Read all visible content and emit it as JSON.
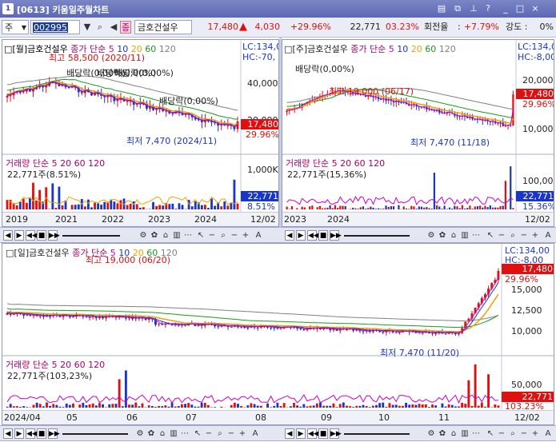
{
  "window": {
    "number": "1",
    "title": "[0613] 키움일주월차트",
    "buttons": [
      "▤",
      "⧉",
      "⊥",
      "?",
      "_",
      "□",
      "×"
    ]
  },
  "toolbar": {
    "market": "주",
    "code": "002995",
    "stock_badge": "종",
    "stock_name": "금호건설우",
    "price": "17,480",
    "change": "4,030",
    "change_pct": "+29.96%",
    "volume": "22,771",
    "volume_pct": "03.23%",
    "turnover_label": "회전율",
    "turnover": "+7.79%",
    "strength_label": "강도 :",
    "strength": "0%"
  },
  "colors": {
    "up": "#e01010",
    "down": "#1a36c8",
    "ma5": "#cc00cc",
    "ma10": "#1a36c8",
    "ma20": "#f0a000",
    "ma60": "#1a9a1a",
    "ma120": "#808080",
    "accent": "#5c68b4"
  },
  "panels": {
    "monthly": {
      "title": "[월]금호건설우",
      "price_tag": "17,480",
      "change_tag": "29.96%",
      "lc": "LC:134,0",
      "hc": "HC:-70,",
      "high_annot": "최고 58,500 (2020/11)",
      "low_annot": "최저 7,470 (2024/11)",
      "div1": "배당락(0,00%)",
      "div2": "배당락(0,00%)",
      "div3": "배당락(0,00%)",
      "div4": "배당락(0,00%)",
      "y_ticks": [
        "40,000",
        "20,000"
      ],
      "vol_tick": "1,000K",
      "vol_tag": "22,771",
      "vol_pct_tag": "8.51%",
      "vol_title": "거래량 단순 5 20 60 120",
      "vol_value": "22,771주(8.51%)",
      "x_ticks": [
        "2019",
        "2021",
        "2022",
        "2023",
        "2024"
      ],
      "x_end": "12/02"
    },
    "weekly": {
      "title": "[주]금호건설우",
      "price_tag": "17,480",
      "change_tag": "29.96%",
      "lc": "LC:134,0",
      "hc": "HC:-8,00",
      "high_annot": "최고 19,000 (06/17)",
      "low_annot": "최저 7,470 (11/18)",
      "div1": "배당락(0,00%)",
      "y_ticks": [
        "20,000",
        "10,000"
      ],
      "vol_tick": "100,000",
      "vol_tag": "22,771",
      "vol_pct_tag": "15.36%",
      "vol_title": "거래량 단순 5 20 60 120",
      "vol_value": "22,771주(15,36%)",
      "x_ticks": [
        "2023",
        "2024"
      ],
      "x_end": "12/02"
    },
    "daily": {
      "title": "[일]금호건설우",
      "price_tag": "17,480",
      "change_tag": "29.96%",
      "lc": "LC:134,00",
      "hc": "HC:-8,00",
      "high_annot": "최고 19,000 (06/20)",
      "low_annot": "최저 7,470 (11/20)",
      "y_ticks": [
        "15,000",
        "12,500",
        "10,000"
      ],
      "vol_tick": "50,000",
      "vol_tag": "22,771",
      "vol_pct_tag": "103.23%",
      "vol_title": "거래량 단순 5 20 60 120",
      "vol_value": "22,771주(103,23%)",
      "x_ticks": [
        "2024/04",
        "05",
        "06",
        "07",
        "08",
        "09",
        "10",
        "11"
      ],
      "x_end": "12/02"
    }
  },
  "legend": {
    "close": "종가",
    "simple": "단순",
    "p5": "5",
    "p10": "10",
    "p20": "20",
    "p60": "60",
    "p120": "120"
  }
}
